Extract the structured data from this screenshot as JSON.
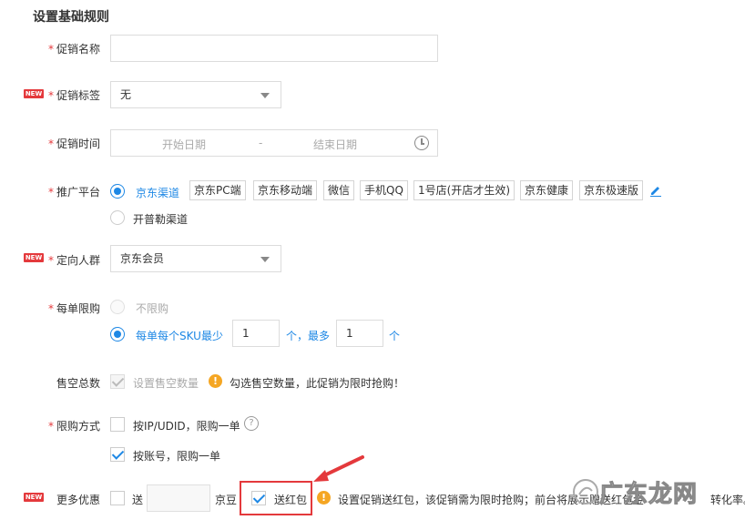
{
  "section_title": "设置基础规则",
  "badge_new": "NEW",
  "required_mark": "*",
  "promo_name": {
    "label": "促销名称",
    "value": ""
  },
  "promo_tag": {
    "label": "促销标签",
    "value": "无"
  },
  "promo_time": {
    "label": "促销时间",
    "start_placeholder": "开始日期",
    "separator": "-",
    "end_placeholder": "结束日期"
  },
  "platform": {
    "label": "推广平台",
    "option_jd": "京东渠道",
    "tags": [
      "京东PC端",
      "京东移动端",
      "微信",
      "手机QQ",
      "1号店(开店才生效)",
      "京东健康",
      "京东极速版"
    ],
    "option_pujin": "开普勒渠道"
  },
  "audience": {
    "label": "定向人群",
    "value": "京东会员"
  },
  "order_limit": {
    "label": "每单限购",
    "option_none": "不限购",
    "option_sku": "每单每个SKU最少",
    "min_value": "1",
    "mid_text": "个，最多",
    "max_value": "1",
    "unit": "个"
  },
  "sold_out": {
    "label": "售空总数",
    "checkbox_label": "设置售空数量",
    "warning": "勾选售空数量，此促销为限时抢购！"
  },
  "limit_method": {
    "label": "限购方式",
    "option_ip": "按IP/UDID，限购一单",
    "help": "?",
    "option_account": "按账号，限购一单"
  },
  "more_offers": {
    "label": "更多优惠",
    "send_label": "送",
    "bean_unit": "京豆",
    "red_packet_label": "送红包",
    "warning": "设置促销送红包，该促销需为限时抢购；前台将展示赠送红包金",
    "warning_tail": "转化率。"
  },
  "watermark": "广东龙网",
  "colors": {
    "accent": "#1e88e5",
    "required": "#e4393c",
    "warn": "#f5a623"
  }
}
